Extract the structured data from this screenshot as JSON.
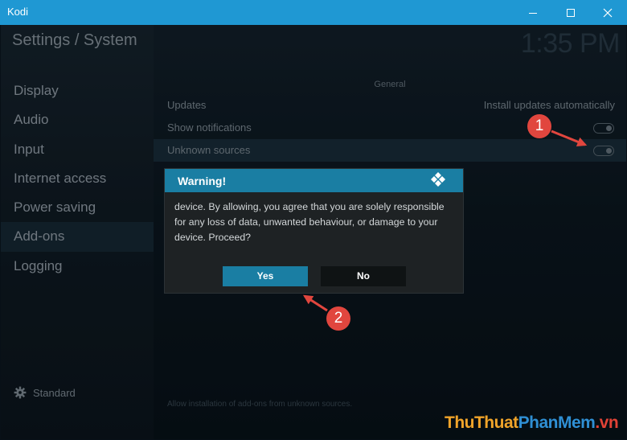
{
  "window": {
    "title": "Kodi"
  },
  "header": {
    "page_title": "Settings / System",
    "clock": "1:35 PM"
  },
  "sidebar": {
    "items": [
      {
        "label": "Display"
      },
      {
        "label": "Audio"
      },
      {
        "label": "Input"
      },
      {
        "label": "Internet access"
      },
      {
        "label": "Power saving"
      },
      {
        "label": "Add-ons",
        "active": true
      },
      {
        "label": "Logging"
      }
    ],
    "level_label": "Standard"
  },
  "settings": {
    "group_header": "General",
    "rows": [
      {
        "label": "Updates",
        "value": "Install updates automatically"
      },
      {
        "label": "Show notifications",
        "toggle": "off"
      },
      {
        "label": "Unknown sources",
        "toggle": "off",
        "highlighted": true
      }
    ],
    "hint": "Allow installation of add-ons from unknown sources."
  },
  "dialog": {
    "title": "Warning!",
    "message_line1": "device. By allowing, you agree that you are solely responsible",
    "message_line2": "for any loss of data, unwanted behaviour, or damage to your",
    "message_line3": "device. Proceed?",
    "yes_label": "Yes",
    "no_label": "No"
  },
  "annotations": {
    "marker1": "1",
    "marker2": "2"
  },
  "watermark": {
    "part1": "ThuThuat",
    "part2": "PhanMem",
    "part3": ".vn"
  },
  "colors": {
    "titlebar": "#1f98d3",
    "dialog_header": "#1a7ea3",
    "yes_button": "#1a7ea3",
    "marker": "#e1463e"
  },
  "icons": [
    "minimize-icon",
    "maximize-icon",
    "close-icon",
    "gear-icon",
    "kodi-logo-icon"
  ]
}
